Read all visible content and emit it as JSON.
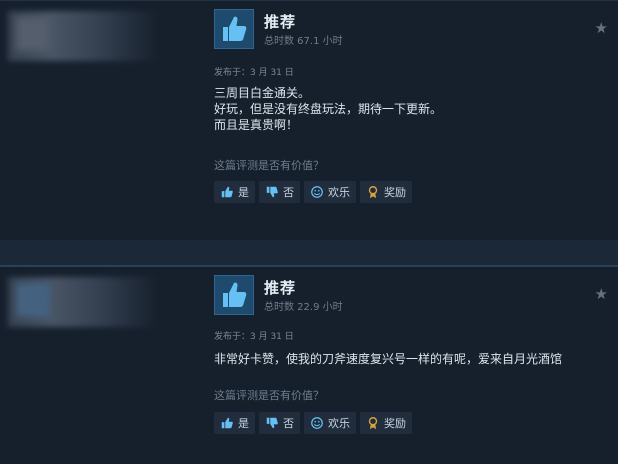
{
  "reviews": [
    {
      "recommendation": "推荐",
      "hours": "总时数 67.1 小时",
      "posted": "发布于：3 月 31 日",
      "lines": [
        "三周目白金通关。",
        "好玩，但是没有终盘玩法，期待一下更新。",
        "而且是真贵啊！"
      ],
      "helpful_question": "这篇评测是否有价值？",
      "buttons": {
        "yes": "是",
        "no": "否",
        "funny": "欢乐",
        "award": "奖励"
      }
    },
    {
      "recommendation": "推荐",
      "hours": "总时数 22.9 小时",
      "posted": "发布于：3 月 31 日",
      "lines": [
        "非常好卡赞，使我的刀斧速度复兴号一样的有呢，爱来自月光酒馆"
      ],
      "helpful_question": "这篇评测是否有价值？",
      "buttons": {
        "yes": "是",
        "no": "否",
        "funny": "欢乐",
        "award": "奖励"
      }
    }
  ],
  "icons": {
    "thumb": "thumbs-up-icon",
    "star": "star-icon"
  },
  "colors": {
    "background": "#1b2838",
    "card": "#16202d",
    "thumb_box": "#1e4a6e",
    "thumb": "#66c0f4",
    "award": "#d6a53a"
  }
}
